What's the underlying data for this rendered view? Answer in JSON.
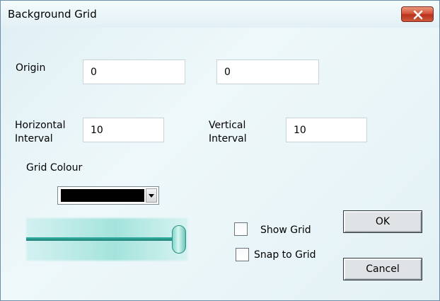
{
  "window": {
    "title": "Background Grid"
  },
  "origin": {
    "label": "Origin",
    "x_value": "0",
    "y_value": "0"
  },
  "horizontal_interval": {
    "label_line1": "Horizontal",
    "label_line2": "Interval",
    "value": "10"
  },
  "vertical_interval": {
    "label_line1": "Vertical",
    "label_line2": "Interval",
    "value": "10"
  },
  "grid_colour": {
    "label": "Grid Colour",
    "selected_color": "#000000"
  },
  "slider": {
    "level": 1.0
  },
  "options": {
    "show_grid_label": "Show Grid",
    "show_grid_checked": false,
    "snap_to_grid_label": "Snap to Grid",
    "snap_to_grid_checked": false
  },
  "buttons": {
    "ok_label": "OK",
    "cancel_label": "Cancel"
  },
  "icons": {
    "close": "close-icon",
    "dropdown": "chevron-down-icon"
  },
  "colors": {
    "close_button": "#c9432a",
    "slider_accent": "#2aa89b"
  }
}
